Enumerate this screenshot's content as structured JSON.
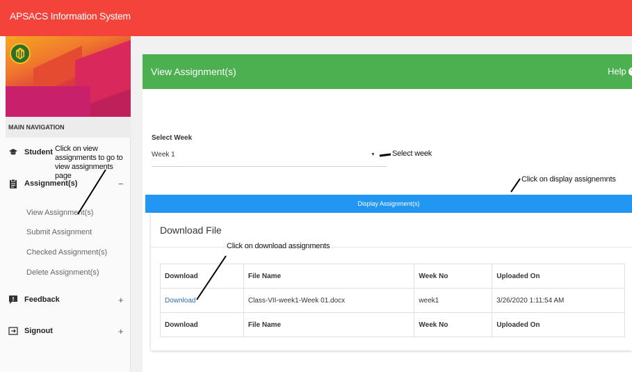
{
  "app": {
    "title": "APSACS Information System"
  },
  "sidebar": {
    "heading": "MAIN NAVIGATION",
    "items": [
      {
        "label": "Student",
        "icon": "graduation-cap-icon",
        "toggle": ""
      },
      {
        "label": "Assignment(s)",
        "icon": "clipboard-icon",
        "toggle": "−"
      },
      {
        "label": "Feedback",
        "icon": "feedback-icon",
        "toggle": "+"
      },
      {
        "label": "Signout",
        "icon": "signout-icon",
        "toggle": "+"
      }
    ],
    "subitems": [
      "View Assignment(s)",
      "Submit Assignment",
      "Checked Assignment(s)",
      "Delete Assignment(s)"
    ]
  },
  "main": {
    "title": "View Assignment(s)",
    "help_label": "Help",
    "help_icon": "?",
    "week_label": "Select Week",
    "week_value": "Week 1",
    "display_button": "Display Assignment(s)",
    "download_title": "Download File",
    "table": {
      "headers": [
        "Download",
        "File Name",
        "Week No",
        "Uploaded On"
      ],
      "rows": [
        [
          "Download",
          "Class-VII-week1-Week 01.docx",
          "week1",
          "3/26/2020 1:11:54 AM"
        ]
      ],
      "footer": [
        "Download",
        "File Name",
        "Week No",
        "Uploaded On"
      ]
    }
  },
  "annotations": {
    "view": "Click on view assignments to go to view assignments page",
    "week": "Select week",
    "display": "Click on display assignemnts",
    "download": "Click on download assignments"
  },
  "colors": {
    "topbar": "#f4433a",
    "header": "#4caf50",
    "button": "#2196f3",
    "link": "#2f6db5"
  }
}
